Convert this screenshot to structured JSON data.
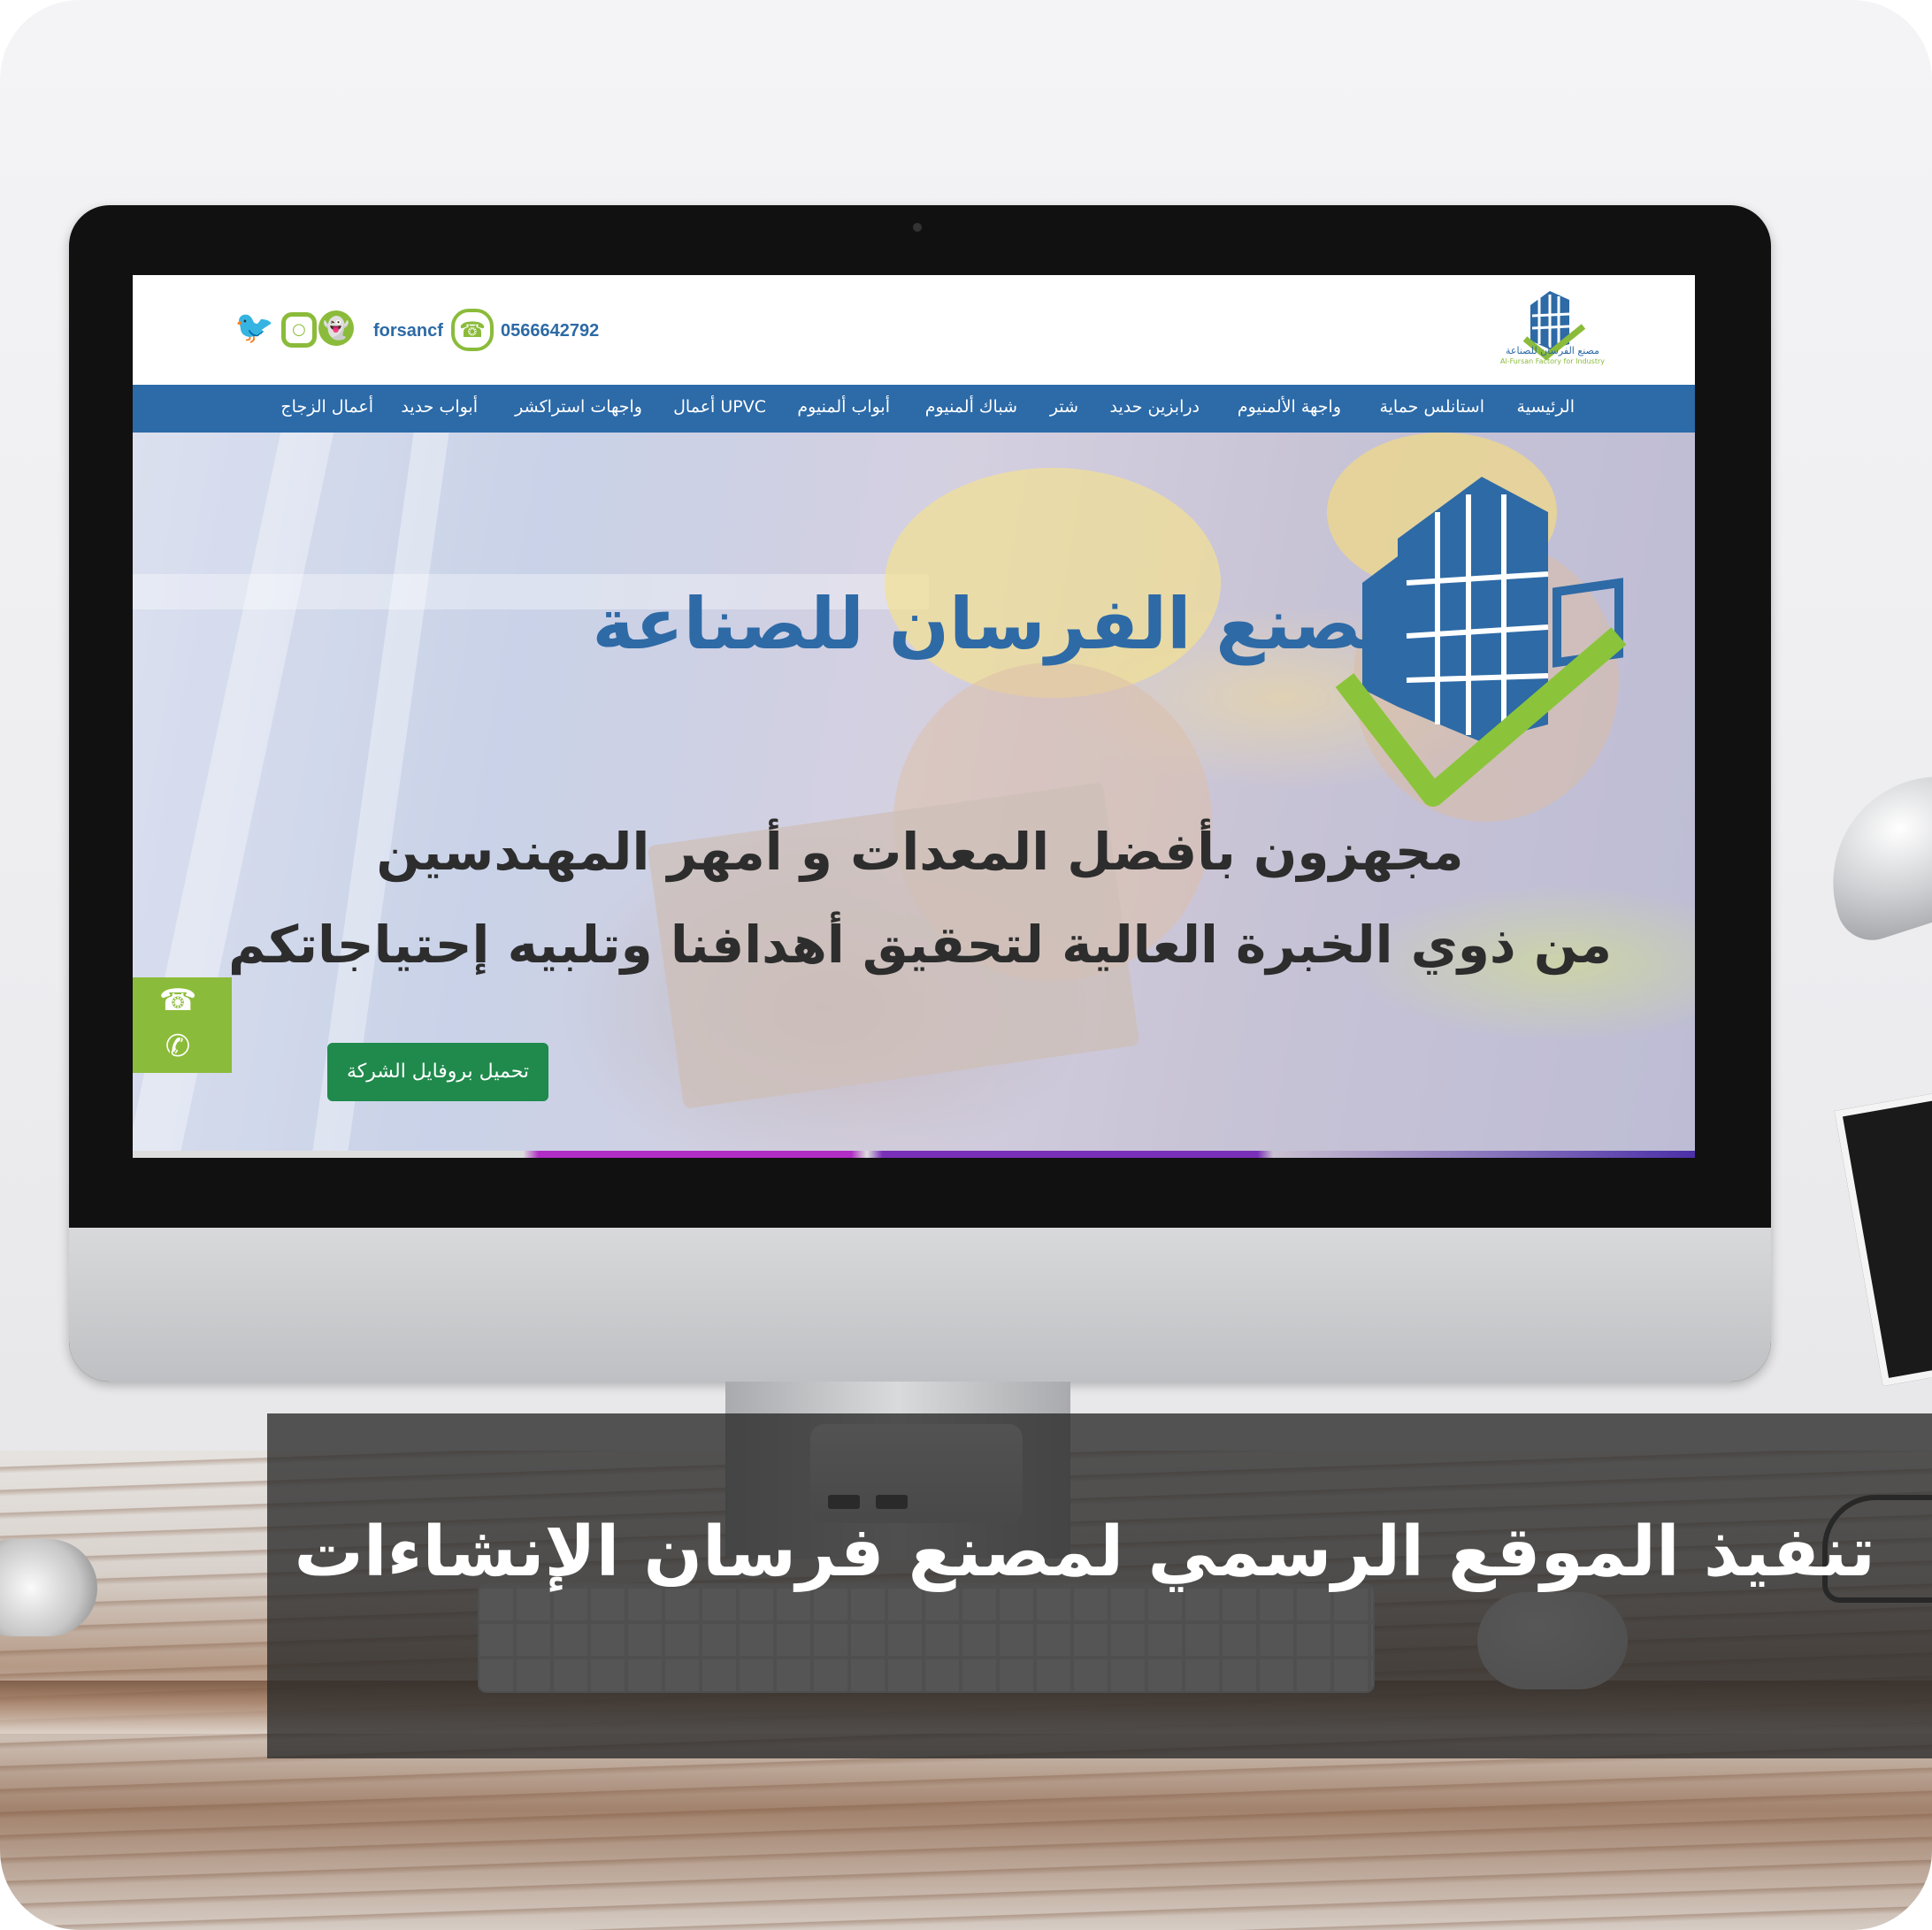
{
  "header": {
    "phone": "0566642792",
    "social_handle": "forsancf",
    "social_icons": [
      "twitter-icon",
      "instagram-icon",
      "snapchat-icon",
      "whatsapp-icon"
    ],
    "logo_text_ar": "مصنع الفرسان للصناعة",
    "logo_text_en": "Al-Fursan Factory for Industry"
  },
  "nav": {
    "items": [
      "الرئيسية",
      "استانلس حماية",
      "واجهة الألمنيوم",
      "درابزين حديد",
      "شتر",
      "شباك ألمنيوم",
      "أبواب ألمنيوم",
      "UPVC أعمال",
      "واجهات استراكشر",
      "أبواب حديد",
      "أعمال الزجاج"
    ]
  },
  "hero": {
    "brand": "مصنع الفرسان للصناعة",
    "line1": "مجهزون بأفضل المعدات و أمهر المهندسين",
    "line2": "من ذوي الخبرة العالية لتحقيق أهدافنا وتلبيه إحتياجاتكم",
    "cta_label": "تحميل بروفايل الشركة",
    "float_icons": [
      "whatsapp-icon",
      "phone-icon"
    ]
  },
  "banner": {
    "title": "تنفيذ الموقع الرسمي لمصنع فرسان الإنشاءات"
  },
  "colors": {
    "nav_blue": "#2c6aa8",
    "accent_green": "#8bbb3a",
    "cta_green": "#1f8a4c",
    "brand_blue": "#2e6aa6"
  }
}
